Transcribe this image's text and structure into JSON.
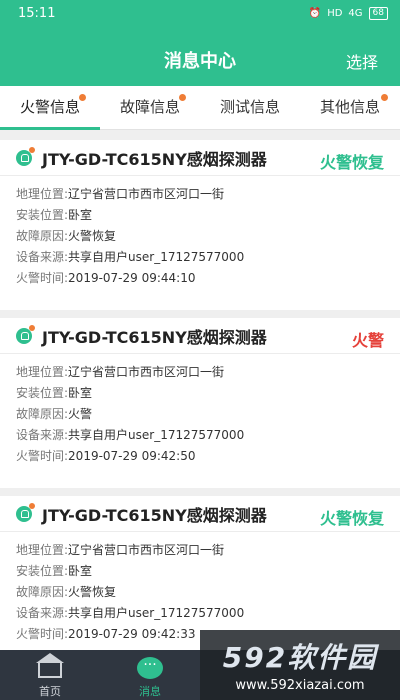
{
  "status_bar": {
    "time": "15:11",
    "signal": "4G",
    "hd": "HD",
    "battery": "68"
  },
  "app_bar": {
    "title": "消息中心",
    "action": "选择"
  },
  "tabs": [
    {
      "label": "火警信息",
      "dot": true,
      "active": true
    },
    {
      "label": "故障信息",
      "dot": true,
      "active": false
    },
    {
      "label": "测试信息",
      "dot": false,
      "active": false
    },
    {
      "label": "其他信息",
      "dot": true,
      "active": false
    }
  ],
  "messages": [
    {
      "device": "JTY-GD-TC615NY感烟探测器",
      "status": "火警恢复",
      "rows": [
        {
          "k": "地理位置:",
          "v": "辽宁省营口市西市区河口一街"
        },
        {
          "k": "安装位置:",
          "v": "卧室"
        },
        {
          "k": "故障原因:",
          "v": "火警恢复"
        },
        {
          "k": "设备来源:",
          "v": "共享自用户user_17127577000"
        },
        {
          "k": "火警时间:",
          "v": "2019-07-29 09:44:10"
        }
      ]
    },
    {
      "device": "JTY-GD-TC615NY感烟探测器",
      "status": "火警",
      "rows": [
        {
          "k": "地理位置:",
          "v": "辽宁省营口市西市区河口一街"
        },
        {
          "k": "安装位置:",
          "v": "卧室"
        },
        {
          "k": "故障原因:",
          "v": "火警"
        },
        {
          "k": "设备来源:",
          "v": "共享自用户user_17127577000"
        },
        {
          "k": "火警时间:",
          "v": "2019-07-29 09:42:50"
        }
      ]
    },
    {
      "device": "JTY-GD-TC615NY感烟探测器",
      "status": "火警恢复",
      "rows": [
        {
          "k": "地理位置:",
          "v": "辽宁省营口市西市区河口一街"
        },
        {
          "k": "安装位置:",
          "v": "卧室"
        },
        {
          "k": "故障原因:",
          "v": "火警恢复"
        },
        {
          "k": "设备来源:",
          "v": "共享自用户user_17127577000"
        },
        {
          "k": "火警时间:",
          "v": "2019-07-29 09:42:33"
        }
      ]
    }
  ],
  "bottom_nav": [
    {
      "label": "首页",
      "icon": "home-icon",
      "active": false
    },
    {
      "label": "消息",
      "icon": "message-icon",
      "active": true
    }
  ],
  "watermark": {
    "brand": "592软件园",
    "url": "www.592xiazai.com"
  },
  "colors": {
    "primary": "#2fbf8f",
    "alarm": "#e5413a",
    "dot": "#ef7d36",
    "nav_bg": "#2f3640"
  }
}
